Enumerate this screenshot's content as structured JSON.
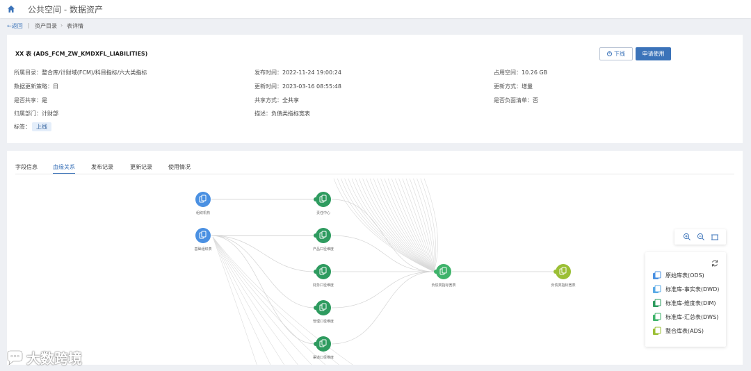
{
  "header": {
    "title": "公共空间 - 数据资产"
  },
  "breadcrumb": {
    "back": "←返回",
    "sep": "|",
    "item1": "资产目录",
    "arrow": "›",
    "item2": "表详情"
  },
  "detail": {
    "title": "XX 表 (ADS_FCM_ZW_KMDXFL_LIABILITIES)",
    "buttons": {
      "offline": "下线",
      "offline_icon": "①",
      "apply": "申请使用"
    },
    "fields": [
      {
        "label": "所属目录：",
        "value": "整合库/计财域(FCM)/科目指标/六大类指标"
      },
      {
        "label": "发布时间：",
        "value": "2022-11-24 19:00:24"
      },
      {
        "label": "占用空间：",
        "value": "10.26 GB"
      },
      {
        "label": "数据更新策略：",
        "value": "日"
      },
      {
        "label": "更新时间：",
        "value": "2023-03-16 08:55:48"
      },
      {
        "label": "更新方式：",
        "value": "增量"
      },
      {
        "label": "是否共享：",
        "value": "是"
      },
      {
        "label": "共享方式：",
        "value": "全共享"
      },
      {
        "label": "是否负面清单：",
        "value": "否"
      },
      {
        "label": "归属部门：",
        "value": "计财部"
      },
      {
        "label": "描述：",
        "value": "负债类指标宽表"
      }
    ],
    "tag_label": "标签：",
    "tag_value": "上线"
  },
  "tabs": [
    {
      "label": "字段信息",
      "active": false
    },
    {
      "label": "血缘关系",
      "active": true
    },
    {
      "label": "发布记录",
      "active": false
    },
    {
      "label": "更新记录",
      "active": false
    },
    {
      "label": "使用情况",
      "active": false
    }
  ],
  "graph": {
    "nodes": [
      {
        "label": "组织机构",
        "type": "ODS"
      },
      {
        "label": "基础组织表",
        "type": "ODS"
      },
      {
        "label": "责任中心",
        "type": "DIM"
      },
      {
        "label": "产品口径维度",
        "type": "DIM"
      },
      {
        "label": "财务口径维度",
        "type": "DIM"
      },
      {
        "label": "管理口径维度",
        "type": "DIM"
      },
      {
        "label": "渠道口径维度",
        "type": "DIM"
      },
      {
        "label": "负债类指标宽表",
        "type": "DWS"
      },
      {
        "label": "负债类指标宽表",
        "type": "ADS"
      }
    ]
  },
  "legend": {
    "items": [
      {
        "label": "原始库表(ODS)",
        "color": "#4a90e2"
      },
      {
        "label": "标准库-事实表(DWD)",
        "color": "#5aa9e6"
      },
      {
        "label": "标准库-维度表(DIM)",
        "color": "#2e9b5f"
      },
      {
        "label": "标准库-汇总表(DWS)",
        "color": "#3fb36b"
      },
      {
        "label": "整合库表(ADS)",
        "color": "#9bbf35"
      }
    ]
  },
  "watermark": {
    "text": "大数跨境"
  }
}
